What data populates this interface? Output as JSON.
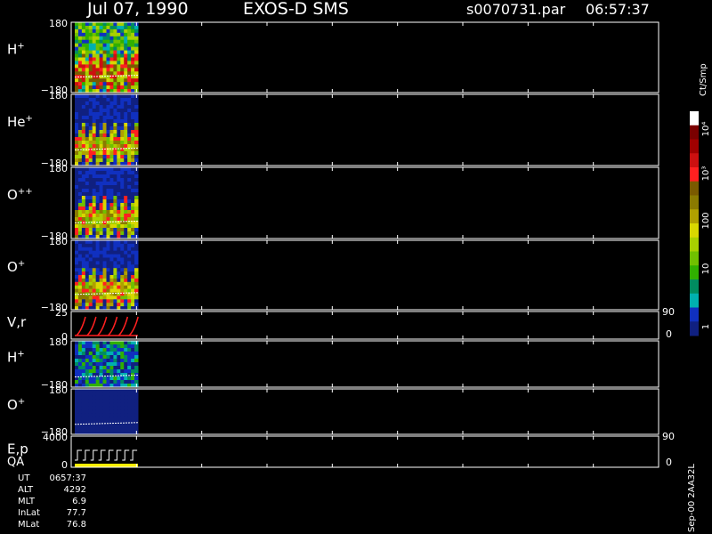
{
  "header": {
    "date": "Jul 07, 1990",
    "mission": "EXOS-D SMS",
    "file": "s0070731.par",
    "time": "06:57:37"
  },
  "colorbar": {
    "unit": "Ct/Smp",
    "labels": [
      "10⁴",
      "10³",
      "100",
      "10",
      "1"
    ],
    "colors": [
      "#ffffff",
      "#7a0000",
      "#a00000",
      "#cc1010",
      "#ff2020",
      "#7a5a00",
      "#8a7a00",
      "#b0a000",
      "#d8d800",
      "#a8d000",
      "#70c000",
      "#30b000",
      "#008c60",
      "#00b0b0",
      "#1030c0",
      "#102080"
    ]
  },
  "footer": {
    "rows": [
      {
        "label": "UT",
        "value": "0657:37"
      },
      {
        "label": "ALT",
        "value": "4292"
      },
      {
        "label": "MLT",
        "value": "6.9"
      },
      {
        "label": "InLat",
        "value": "77.7"
      },
      {
        "label": "MLat",
        "value": "76.8"
      }
    ],
    "version": "Sep-00 2AA32L"
  },
  "chart_data": {
    "type": "heatmap",
    "panels": [
      {
        "label": "H",
        "sup": "+",
        "ymax": "180",
        "ymin": "−180",
        "kind": "spectrogram",
        "intensity": "high"
      },
      {
        "label": "He",
        "sup": "+",
        "ymax": "180",
        "ymin": "−180",
        "kind": "spectrogram",
        "intensity": "mid"
      },
      {
        "label": "O",
        "sup": "++",
        "ymax": "180",
        "ymin": "−180",
        "kind": "spectrogram",
        "intensity": "mid"
      },
      {
        "label": "O",
        "sup": "+",
        "ymax": "180",
        "ymin": "−180",
        "kind": "spectrogram",
        "intensity": "mid"
      },
      {
        "label": "V,r",
        "sup": "",
        "ymax": "25",
        "ymin": "0",
        "right_top": "90",
        "right_bottom": "0",
        "kind": "line"
      },
      {
        "label": "H",
        "sup": "+",
        "ymax": "180",
        "ymin": "−180",
        "kind": "spectrogram",
        "intensity": "low"
      },
      {
        "label": "O",
        "sup": "+",
        "ymax": "180",
        "ymin": "−180",
        "kind": "spectrogram",
        "intensity": "blank"
      },
      {
        "label": "E,p",
        "label2": "QA",
        "sup": "",
        "ymax": "4000",
        "ymin": "0",
        "right_top": "90",
        "right_bottom": "0",
        "kind": "step"
      }
    ],
    "data_extent_fraction": 0.12
  }
}
